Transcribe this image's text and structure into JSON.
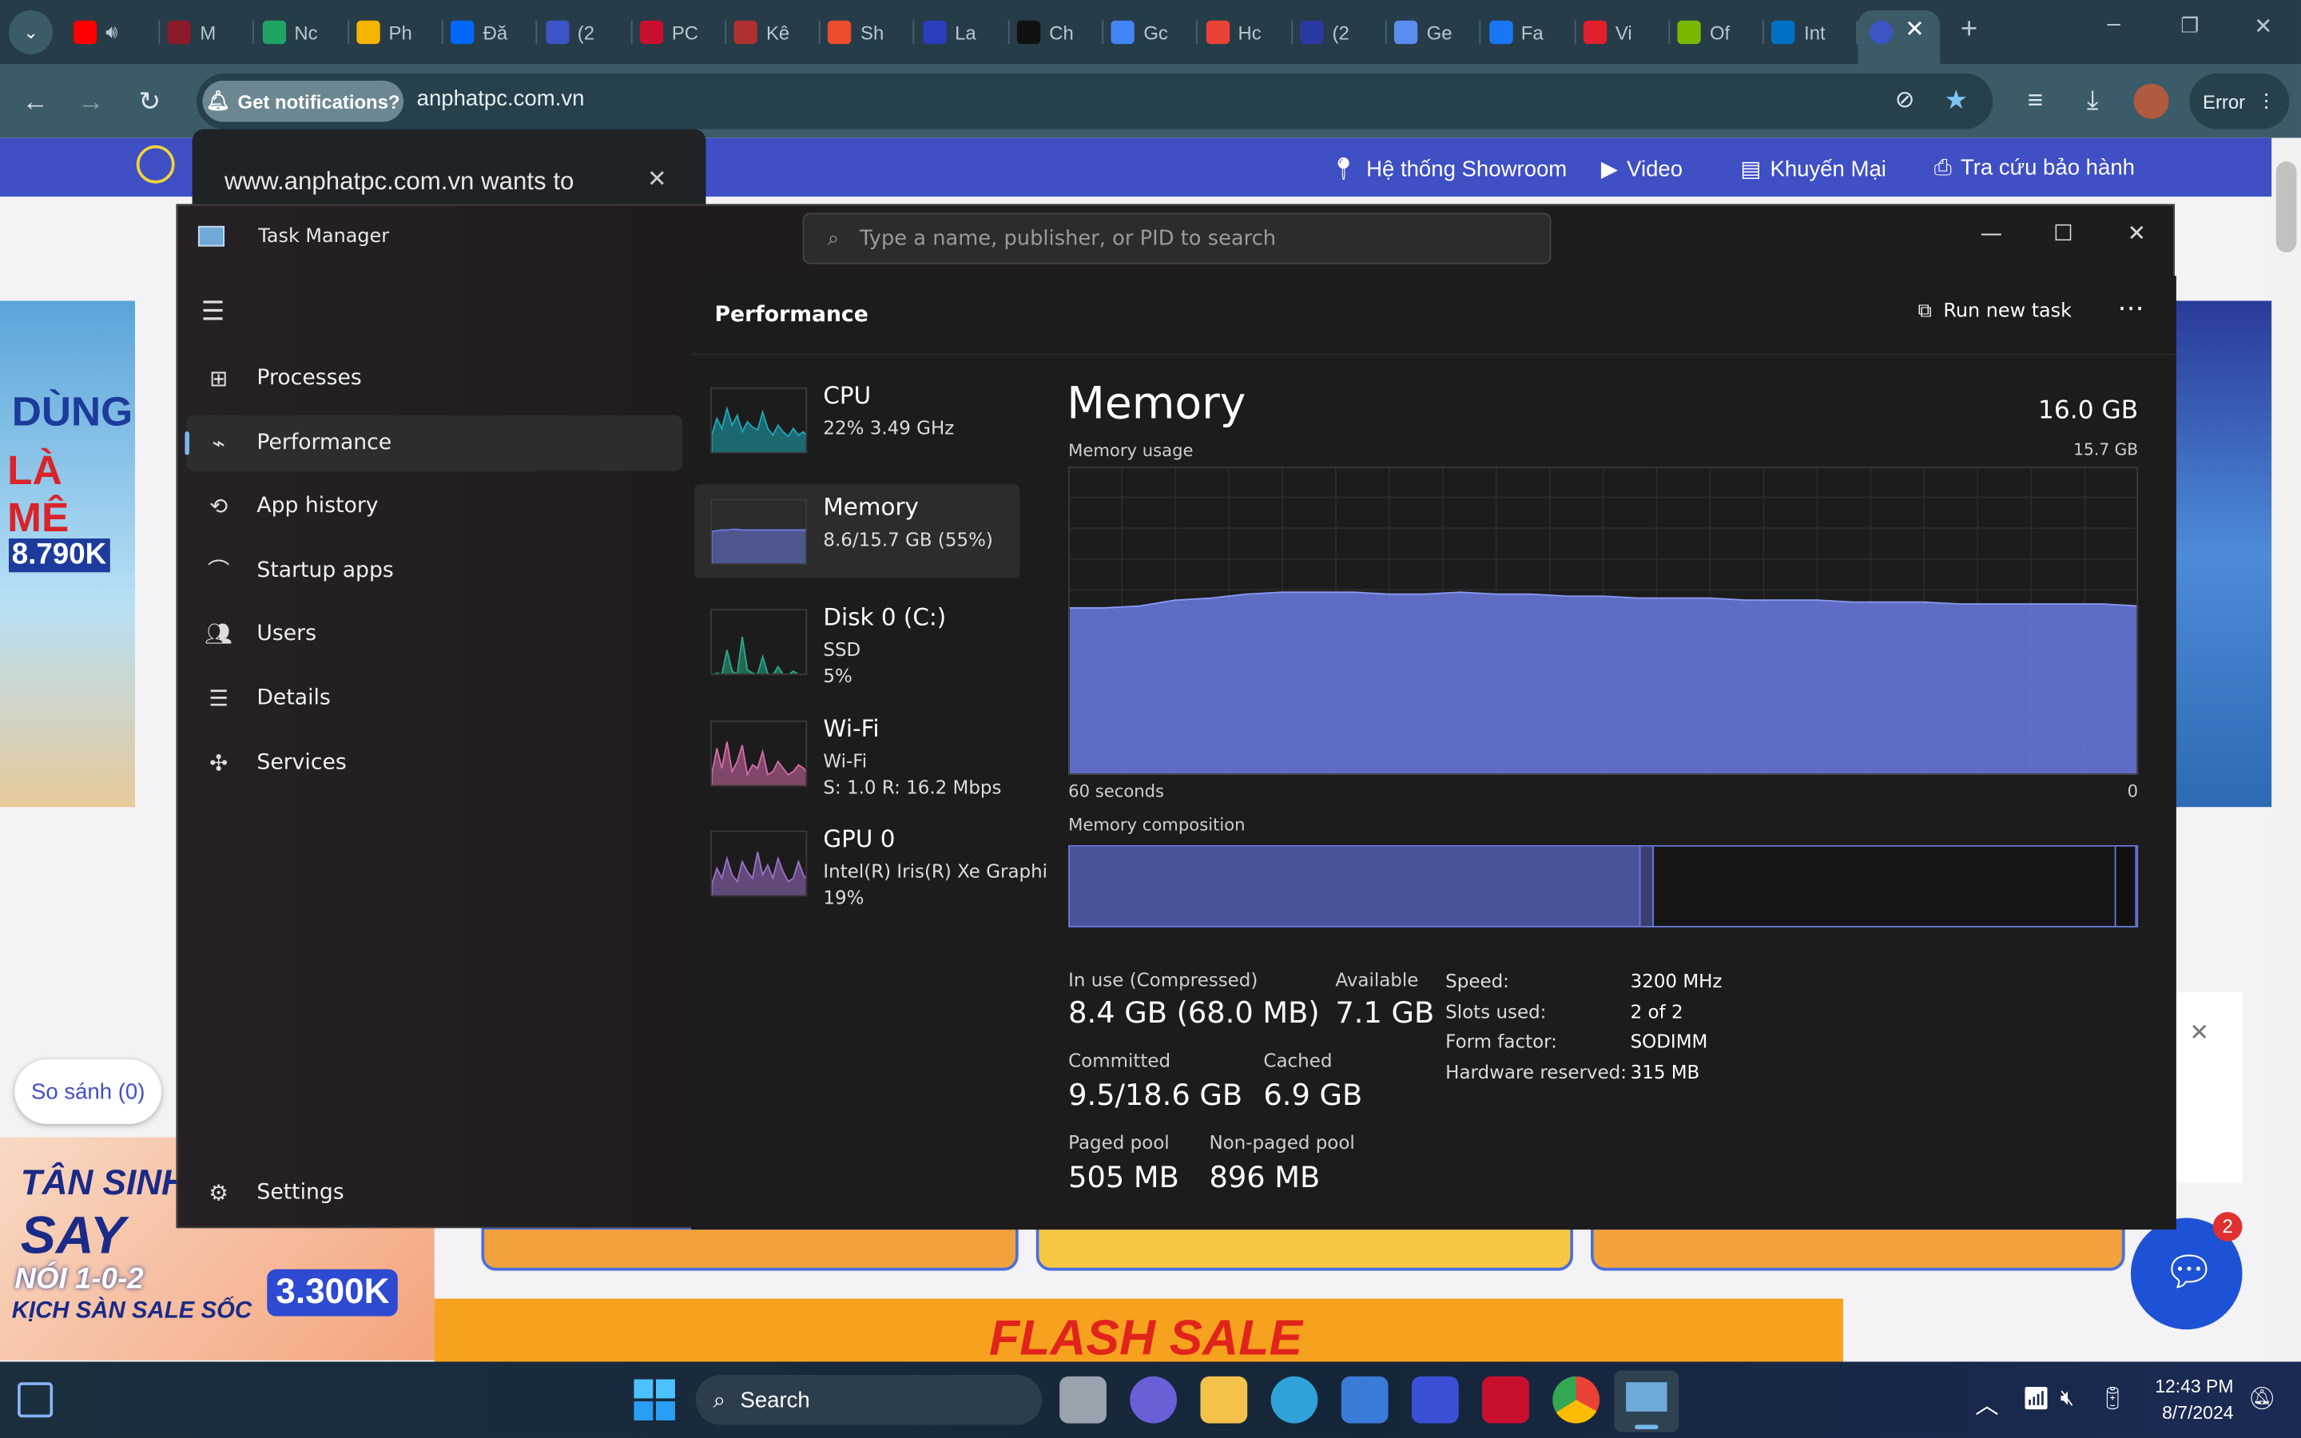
{
  "browser": {
    "tabs": [
      {
        "title": "",
        "color": "#ff0000",
        "audio": true
      },
      {
        "title": "M",
        "color": "#8b1a2b"
      },
      {
        "title": "Nc",
        "color": "#1fa463"
      },
      {
        "title": "Ph",
        "color": "#f4b400"
      },
      {
        "title": "Đă",
        "color": "#0068ff"
      },
      {
        "title": "(2",
        "color": "#3d54c7"
      },
      {
        "title": "PC",
        "color": "#c8102e"
      },
      {
        "title": "Kê",
        "color": "#b03030"
      },
      {
        "title": "Sh",
        "color": "#ee4d2d"
      },
      {
        "title": "La",
        "color": "#2b3dbf"
      },
      {
        "title": "Ch",
        "color": "#111111"
      },
      {
        "title": "Gc",
        "color": "#4285f4"
      },
      {
        "title": "Hc",
        "color": "#ea4335"
      },
      {
        "title": "(2",
        "color": "#2a3aa0"
      },
      {
        "title": "Ge",
        "color": "#5b8def"
      },
      {
        "title": "Fa",
        "color": "#1877f2"
      },
      {
        "title": "Vi",
        "color": "#e0202a"
      },
      {
        "title": "Of",
        "color": "#76b900"
      },
      {
        "title": "Int",
        "color": "#0071c5"
      }
    ],
    "notification_chip": "Get notifications?",
    "url": "anphatpc.com.vn",
    "profile_status": "Error",
    "permission_prompt": "www.anphatpc.com.vn wants to"
  },
  "website": {
    "nav": [
      "Hệ thống Showroom",
      "Video",
      "Khuyến Mại",
      "Tra cứu bảo hành"
    ],
    "compare_label": "So sánh (0)",
    "chat_badge": "2",
    "left_ad": [
      "DÙNG",
      "LÀ MÊ",
      "8.790K"
    ],
    "bottom_ad": [
      "TÂN SINH",
      "SAY",
      "NÓI 1-0-2",
      "KỊCH SÀN SALE SỐC",
      "3.300K"
    ],
    "flash_sale": "FLASH SALE"
  },
  "task_manager": {
    "title": "Task Manager",
    "search_placeholder": "Type a name, publisher, or PID to search",
    "nav": [
      {
        "label": "Processes",
        "icon": "grid-icon"
      },
      {
        "label": "Performance",
        "icon": "pulse-icon",
        "selected": true
      },
      {
        "label": "App history",
        "icon": "history-icon"
      },
      {
        "label": "Startup apps",
        "icon": "speedometer-icon"
      },
      {
        "label": "Users",
        "icon": "users-icon"
      },
      {
        "label": "Details",
        "icon": "list-icon"
      },
      {
        "label": "Services",
        "icon": "puzzle-icon"
      }
    ],
    "settings": "Settings",
    "page_title": "Performance",
    "run_new_task": "Run new task",
    "devices": [
      {
        "name": "CPU",
        "lines": [
          "22%  3.49 GHz"
        ],
        "color": "#1ea7b8",
        "spark": [
          30,
          55,
          40,
          70,
          45,
          60,
          35,
          50,
          42,
          38,
          65,
          40,
          30,
          45,
          35,
          28,
          40,
          30,
          35,
          25
        ]
      },
      {
        "name": "Memory",
        "lines": [
          "8.6/15.7 GB (55%)"
        ],
        "color": "#6a7ae0",
        "selected": true,
        "spark": [
          53,
          54,
          55,
          55,
          56,
          56,
          55,
          55,
          55,
          55,
          55,
          55,
          55,
          55,
          55,
          55,
          55,
          55,
          55,
          55
        ]
      },
      {
        "name": "Disk 0 (C:)",
        "lines": [
          "SSD",
          "5%"
        ],
        "color": "#2aa88a",
        "spark": [
          2,
          5,
          3,
          40,
          8,
          3,
          60,
          10,
          5,
          3,
          30,
          4,
          2,
          15,
          3,
          2,
          8,
          3,
          2,
          4
        ]
      },
      {
        "name": "Wi-Fi",
        "lines": [
          "Wi-Fi",
          "S: 1.0  R: 16.2 Mbps"
        ],
        "color": "#d46ca8",
        "spark": [
          20,
          60,
          30,
          70,
          25,
          40,
          65,
          20,
          35,
          30,
          55,
          20,
          25,
          40,
          30,
          20,
          25,
          35,
          30,
          20
        ]
      },
      {
        "name": "GPU 0",
        "lines": [
          "Intel(R) Iris(R) Xe Graphi",
          "19%"
        ],
        "color": "#9a70c8",
        "spark": [
          20,
          45,
          30,
          60,
          35,
          25,
          55,
          40,
          30,
          70,
          35,
          50,
          30,
          60,
          40,
          25,
          30,
          55,
          35,
          25
        ]
      }
    ],
    "memory": {
      "heading": "Memory",
      "total": "16.0 GB",
      "usage_label": "Memory usage",
      "usage_max": "15.7 GB",
      "time_label": "60 seconds",
      "time_end": "0",
      "composition_label": "Memory composition",
      "stats": [
        {
          "label": "In use (Compressed)",
          "value": "8.4 GB (68.0 MB)"
        },
        {
          "label": "Available",
          "value": "7.1 GB"
        },
        {
          "label": "Committed",
          "value": "9.5/18.6 GB"
        },
        {
          "label": "Cached",
          "value": "6.9 GB"
        },
        {
          "label": "Paged pool",
          "value": "505 MB"
        },
        {
          "label": "Non-paged pool",
          "value": "896 MB"
        }
      ],
      "specs": [
        {
          "key": "Speed:",
          "value": "3200 MHz"
        },
        {
          "key": "Slots used:",
          "value": "2 of 2"
        },
        {
          "key": "Form factor:",
          "value": "SODIMM"
        },
        {
          "key": "Hardware reserved:",
          "value": "315 MB"
        }
      ]
    }
  },
  "chart_data": {
    "type": "area",
    "title": "Memory usage",
    "xlabel": "60 seconds",
    "ylim": [
      0,
      15.7
    ],
    "xlim": [
      60,
      0
    ],
    "x": [
      60,
      58,
      56,
      54,
      52,
      50,
      48,
      46,
      44,
      42,
      40,
      38,
      36,
      34,
      32,
      30,
      28,
      26,
      24,
      22,
      20,
      18,
      16,
      14,
      12,
      10,
      8,
      6,
      4,
      2,
      0
    ],
    "values": [
      8.5,
      8.5,
      8.6,
      8.9,
      9.0,
      9.2,
      9.3,
      9.3,
      9.3,
      9.2,
      9.2,
      9.3,
      9.2,
      9.2,
      9.1,
      9.1,
      9.0,
      9.0,
      9.0,
      8.9,
      8.9,
      8.9,
      8.8,
      8.8,
      8.8,
      8.7,
      8.7,
      8.7,
      8.7,
      8.7,
      8.6
    ],
    "composition_gb": {
      "in_use": 8.4,
      "modified": 0.2,
      "standby": 6.8,
      "free": 0.3
    },
    "color": "#6a7ae0"
  },
  "taskbar": {
    "search": "Search",
    "time": "12:43 PM",
    "date": "8/7/2024"
  }
}
